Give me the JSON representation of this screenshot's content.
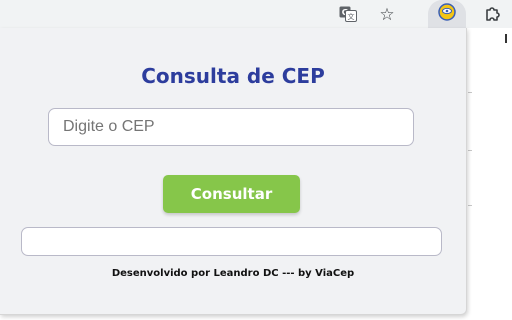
{
  "popup": {
    "title": "Consulta de CEP",
    "input_placeholder": "Digite o CEP",
    "input_value": "",
    "button_label": "Consultar",
    "result_text": "",
    "footer": "Desenvolvido por Leandro DC --- by ViaCep"
  },
  "toolbar": {
    "icons": [
      "translate-icon",
      "bookmark-star-icon",
      "extension-cep-icon",
      "extensions-puzzle-icon"
    ]
  },
  "colors": {
    "title": "#2d3d9d",
    "button": "#86c64a",
    "popup_bg": "#f1f2f4"
  }
}
